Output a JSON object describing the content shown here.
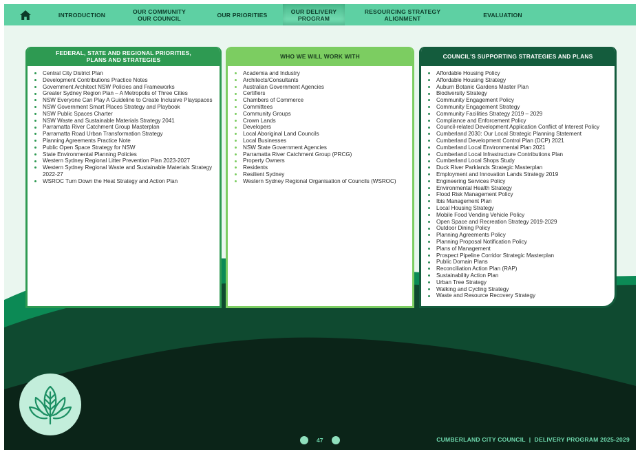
{
  "nav": {
    "items": [
      {
        "label": "INTRODUCTION"
      },
      {
        "label": "OUR COMMUNITY\nOUR COUNCIL"
      },
      {
        "label": "OUR PRIORITIES"
      },
      {
        "label": "OUR DELIVERY\nPROGRAM"
      },
      {
        "label": "RESOURCING STRATEGY\nALIGNMENT"
      },
      {
        "label": "EVALUATION"
      }
    ],
    "active_index": 3
  },
  "columns": [
    {
      "title": "FEDERAL, STATE AND REGIONAL PRIORITIES,\nPLANS AND STRATEGIES",
      "items": [
        "Central City District Plan",
        "Development Contributions Practice Notes",
        "Government Architect NSW Policies and Frameworks",
        "Greater Sydney Region Plan – A Metropolis of Three Cities",
        "NSW Everyone Can Play A Guideline to Create Inclusive Playspaces",
        "NSW Government Smart Places Strategy and Playbook",
        "NSW Public Spaces Charter",
        "NSW Waste and Sustainable Materials Strategy 2041",
        "Parramatta River Catchment Group Masterplan",
        "Parramatta Road Urban Transformation Strategy",
        "Planning Agreements Practice Note",
        "Public Open Space Strategy for NSW",
        "State Environmental Planning Policies",
        "Western Sydney Regional Litter Prevention Plan 2023-2027",
        "Western Sydney Regional Waste and Sustainable Materials Strategy 2022-27",
        "WSROC Turn Down the Heat Strategy and Action Plan"
      ]
    },
    {
      "title": "WHO WE WILL WORK WITH",
      "items": [
        "Academia and Industry",
        "Architects/Consultants",
        "Australian Government Agencies",
        "Certifiers",
        "Chambers of Commerce",
        "Committees",
        "Community Groups",
        "Crown Lands",
        "Developers",
        "Local Aboriginal Land Councils",
        "Local Businesses",
        "NSW State Government Agencies",
        "Parramatta River Catchment Group (PRCG)",
        "Property Owners",
        "Residents",
        "Resilient Sydney",
        "Western Sydney Regional Organisation of Councils (WSROC)"
      ]
    },
    {
      "title": "COUNCIL'S SUPPORTING STRATEGIES AND PLANS",
      "items": [
        "Affordable Housing Policy",
        "Affordable Housing Strategy",
        "Auburn Botanic Gardens Master Plan",
        "Biodiversity Strategy",
        "Community Engagement Policy",
        "Community Engagement Strategy",
        "Community Facilities Strategy 2019 – 2029",
        "Compliance and Enforcement Policy",
        "Council-related Development Application Conflict of Interest Policy",
        "Cumberland 2030: Our Local Strategic Planning Statement",
        "Cumberland Development Control Plan (DCP) 2021",
        "Cumberland Local Environmental Plan 2021",
        "Cumberland Local Infrastructure Contributions Plan",
        "Cumberland Local Shops Study",
        "Duck River Parklands Strategic Masterplan",
        "Employment and Innovation Lands Strategy 2019",
        "Engineering Services Policy",
        "Environmental Health Strategy",
        "Flood Risk Management Policy",
        "Ibis Management Plan",
        "Local Housing Strategy",
        "Mobile Food Vending Vehicle Policy",
        "Open Space and Recreation Strategy 2019-2029",
        "Outdoor Dining Policy",
        "Planning Agreements Policy",
        "Planning Proposal Notification Policy",
        "Plans of Management",
        "Prospect Pipeline Corridor Strategic Masterplan",
        "Public Domain Plans",
        "Reconciliation Action Plan (RAP)",
        "Sustainability Action Plan",
        "Urban Tree Strategy",
        "Walking and Cycling Strategy",
        "Waste and Resource Recovery Strategy"
      ]
    }
  ],
  "footer": {
    "page_number": "47",
    "title": "CUMBERLAND CITY COUNCIL  |  DELIVERY PROGRAM 2025-2029"
  },
  "icons": {
    "home": "home-icon",
    "badge": "lotus-leaf-icon",
    "prev": "previous-page-button",
    "next": "next-page-button"
  },
  "colors": {
    "nav_bg": "#5ed0a3",
    "col1_header": "#2e9a52",
    "col2_header": "#7ccd61",
    "col3_header": "#145c3d",
    "footer_dark": "#0b2418",
    "footer_text": "#6fd9ae"
  }
}
